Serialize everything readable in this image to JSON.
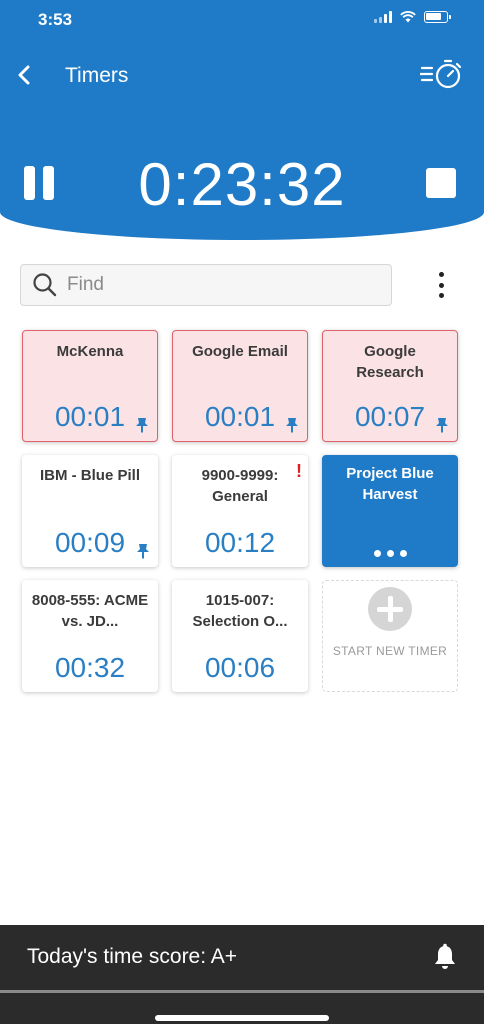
{
  "status_bar": {
    "time": "3:53"
  },
  "header": {
    "title": "Timers",
    "current_timer": "0:23:32"
  },
  "search": {
    "placeholder": "Find",
    "value": ""
  },
  "tiles": [
    {
      "name": "McKenna",
      "time": "00:01",
      "pinned": true,
      "state": "highlighted"
    },
    {
      "name": "Google Email",
      "time": "00:01",
      "pinned": true,
      "state": "highlighted"
    },
    {
      "name": "Google Research",
      "time": "00:07",
      "pinned": true,
      "state": "highlighted"
    },
    {
      "name": "IBM - Blue Pill",
      "time": "00:09",
      "pinned": true,
      "state": "normal"
    },
    {
      "name": "9900-9999: General",
      "time": "00:12",
      "alert": "!",
      "state": "normal"
    },
    {
      "name": "Project Blue Harvest",
      "state": "running"
    },
    {
      "name": "8008-555: ACME vs. JD...",
      "time": "00:32",
      "state": "normal"
    },
    {
      "name": "1015-007: Selection O...",
      "time": "00:06",
      "state": "normal"
    }
  ],
  "new_timer": {
    "label": "START NEW TIMER"
  },
  "footer": {
    "score_text": "Today's time score: A+"
  },
  "colors": {
    "primary": "#1f7bc7",
    "highlight_bg": "#fbe3e5",
    "highlight_border": "#e0636c",
    "footer_bg": "#2b2b2b"
  },
  "icons": [
    "back-icon",
    "timer-list-icon",
    "pause-icon",
    "stop-icon",
    "search-icon",
    "more-vertical-icon",
    "pin-icon",
    "plus-circle-icon",
    "bell-icon"
  ]
}
